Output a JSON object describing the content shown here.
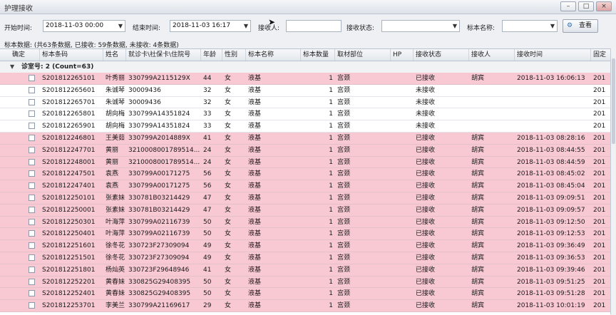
{
  "window": {
    "title": "护理接收",
    "minimize_glyph": "–",
    "restore_glyph": "□",
    "close_glyph": "×"
  },
  "filters": {
    "start_label": "开始时间:",
    "start_value": "2018-11-03 00:00",
    "end_label": "结束时间:",
    "end_value": "2018-11-03 16:17",
    "receiver_label": "接收人:",
    "receiver_value": "",
    "status_label": "接收状态:",
    "status_value": "",
    "specimen_label": "标本名称:",
    "specimen_value": "",
    "search_label": "查看",
    "dropdown_glyph": "▼"
  },
  "summary": {
    "text": "标本数据: (共63条数据, 已接收: 59条数据, 未接收: 4条数据)"
  },
  "grid": {
    "columns": [
      "确定",
      "标本条码",
      "姓名",
      "就诊卡\\社保卡\\住院号",
      "年龄",
      "性别",
      "标本名称",
      "标本数量",
      "取材部位",
      "HP",
      "接收状态",
      "接收人",
      "接收时间",
      "固定"
    ],
    "group": {
      "title": "诊室号: 2 (Count=63)",
      "expand_glyph": "▼"
    },
    "rows": [
      {
        "code": "S201812265101",
        "name": "叶秀丽",
        "card": "330799A2115129X",
        "age": "44",
        "sex": "女",
        "specimen": "液基",
        "qty": "1",
        "site": "宫颈",
        "hp": "",
        "status": "已接收",
        "receiver": "胡宾",
        "time": "2018-11-03 16:06:13",
        "fixed": "201",
        "received": true
      },
      {
        "code": "S201812265601",
        "name": "朱诚琴",
        "card": "30009436",
        "age": "32",
        "sex": "女",
        "specimen": "液基",
        "qty": "1",
        "site": "宫颈",
        "hp": "",
        "status": "未接收",
        "receiver": "",
        "time": "",
        "fixed": "201",
        "received": false
      },
      {
        "code": "S201812265701",
        "name": "朱诚琴",
        "card": "30009436",
        "age": "32",
        "sex": "女",
        "specimen": "液基",
        "qty": "1",
        "site": "宫颈",
        "hp": "",
        "status": "未接收",
        "receiver": "",
        "time": "",
        "fixed": "201",
        "received": false
      },
      {
        "code": "S201812265801",
        "name": "胡向梅",
        "card": "330799A14351824",
        "age": "33",
        "sex": "女",
        "specimen": "液基",
        "qty": "1",
        "site": "宫颈",
        "hp": "",
        "status": "未接收",
        "receiver": "",
        "time": "",
        "fixed": "201",
        "received": false
      },
      {
        "code": "S201812265901",
        "name": "胡向梅",
        "card": "330799A14351824",
        "age": "33",
        "sex": "女",
        "specimen": "液基",
        "qty": "1",
        "site": "宫颈",
        "hp": "",
        "status": "未接收",
        "receiver": "",
        "time": "",
        "fixed": "201",
        "received": false
      },
      {
        "code": "S201812246801",
        "name": "王美茹",
        "card": "330799A2014889X",
        "age": "41",
        "sex": "女",
        "specimen": "液基",
        "qty": "1",
        "site": "宫颈",
        "hp": "",
        "status": "已接收",
        "receiver": "胡宾",
        "time": "2018-11-03 08:28:16",
        "fixed": "201",
        "received": true
      },
      {
        "code": "S201812247701",
        "name": "黄丽",
        "card": "3210008001789514...",
        "age": "24",
        "sex": "女",
        "specimen": "液基",
        "qty": "1",
        "site": "宫颈",
        "hp": "",
        "status": "已接收",
        "receiver": "胡宾",
        "time": "2018-11-03 08:44:55",
        "fixed": "201",
        "received": true
      },
      {
        "code": "S201812248001",
        "name": "黄丽",
        "card": "3210008001789514...",
        "age": "24",
        "sex": "女",
        "specimen": "液基",
        "qty": "1",
        "site": "宫颈",
        "hp": "",
        "status": "已接收",
        "receiver": "胡宾",
        "time": "2018-11-03 08:44:59",
        "fixed": "201",
        "received": true
      },
      {
        "code": "S201812247501",
        "name": "袁燕",
        "card": "330799A00171275",
        "age": "56",
        "sex": "女",
        "specimen": "液基",
        "qty": "1",
        "site": "宫颈",
        "hp": "",
        "status": "已接收",
        "receiver": "胡宾",
        "time": "2018-11-03 08:45:02",
        "fixed": "201",
        "received": true
      },
      {
        "code": "S201812247401",
        "name": "袁燕",
        "card": "330799A00171275",
        "age": "56",
        "sex": "女",
        "specimen": "液基",
        "qty": "1",
        "site": "宫颈",
        "hp": "",
        "status": "已接收",
        "receiver": "胡宾",
        "time": "2018-11-03 08:45:04",
        "fixed": "201",
        "received": true
      },
      {
        "code": "S201812250101",
        "name": "张素妹",
        "card": "330781B03214429",
        "age": "47",
        "sex": "女",
        "specimen": "液基",
        "qty": "1",
        "site": "宫颈",
        "hp": "",
        "status": "已接收",
        "receiver": "胡宾",
        "time": "2018-11-03 09:09:51",
        "fixed": "201",
        "received": true
      },
      {
        "code": "S201812250001",
        "name": "张素妹",
        "card": "330781B03214429",
        "age": "47",
        "sex": "女",
        "specimen": "液基",
        "qty": "1",
        "site": "宫颈",
        "hp": "",
        "status": "已接收",
        "receiver": "胡宾",
        "time": "2018-11-03 09:09:57",
        "fixed": "201",
        "received": true
      },
      {
        "code": "S201812250301",
        "name": "叶海萍",
        "card": "330799A02116739",
        "age": "50",
        "sex": "女",
        "specimen": "液基",
        "qty": "1",
        "site": "宫颈",
        "hp": "",
        "status": "已接收",
        "receiver": "胡宾",
        "time": "2018-11-03 09:12:50",
        "fixed": "201",
        "received": true
      },
      {
        "code": "S201812250401",
        "name": "叶海萍",
        "card": "330799A02116739",
        "age": "50",
        "sex": "女",
        "specimen": "液基",
        "qty": "1",
        "site": "宫颈",
        "hp": "",
        "status": "已接收",
        "receiver": "胡宾",
        "time": "2018-11-03 09:12:53",
        "fixed": "201",
        "received": true
      },
      {
        "code": "S201812251601",
        "name": "徐冬花",
        "card": "330723F27309094",
        "age": "49",
        "sex": "女",
        "specimen": "液基",
        "qty": "1",
        "site": "宫颈",
        "hp": "",
        "status": "已接收",
        "receiver": "胡宾",
        "time": "2018-11-03 09:36:49",
        "fixed": "201",
        "received": true
      },
      {
        "code": "S201812251501",
        "name": "徐冬花",
        "card": "330723F27309094",
        "age": "49",
        "sex": "女",
        "specimen": "液基",
        "qty": "1",
        "site": "宫颈",
        "hp": "",
        "status": "已接收",
        "receiver": "胡宾",
        "time": "2018-11-03 09:36:53",
        "fixed": "201",
        "received": true
      },
      {
        "code": "S201812251801",
        "name": "杨灿英",
        "card": "330723F29648946",
        "age": "41",
        "sex": "女",
        "specimen": "液基",
        "qty": "1",
        "site": "宫颈",
        "hp": "",
        "status": "已接收",
        "receiver": "胡宾",
        "time": "2018-11-03 09:39:46",
        "fixed": "201",
        "received": true
      },
      {
        "code": "S201812252201",
        "name": "黄春妹",
        "card": "330825G29408395",
        "age": "50",
        "sex": "女",
        "specimen": "液基",
        "qty": "1",
        "site": "宫颈",
        "hp": "",
        "status": "已接收",
        "receiver": "胡宾",
        "time": "2018-11-03 09:51:25",
        "fixed": "201",
        "received": true
      },
      {
        "code": "S201812252401",
        "name": "黄春妹",
        "card": "330825G29408395",
        "age": "50",
        "sex": "女",
        "specimen": "液基",
        "qty": "1",
        "site": "宫颈",
        "hp": "",
        "status": "已接收",
        "receiver": "胡宾",
        "time": "2018-11-03 09:51:28",
        "fixed": "201",
        "received": true
      },
      {
        "code": "S201812253701",
        "name": "李美兰",
        "card": "330799A21169617",
        "age": "29",
        "sex": "女",
        "specimen": "液基",
        "qty": "1",
        "site": "宫颈",
        "hp": "",
        "status": "已接收",
        "receiver": "胡宾",
        "time": "2018-11-03 10:01:19",
        "fixed": "201",
        "received": true
      }
    ]
  }
}
